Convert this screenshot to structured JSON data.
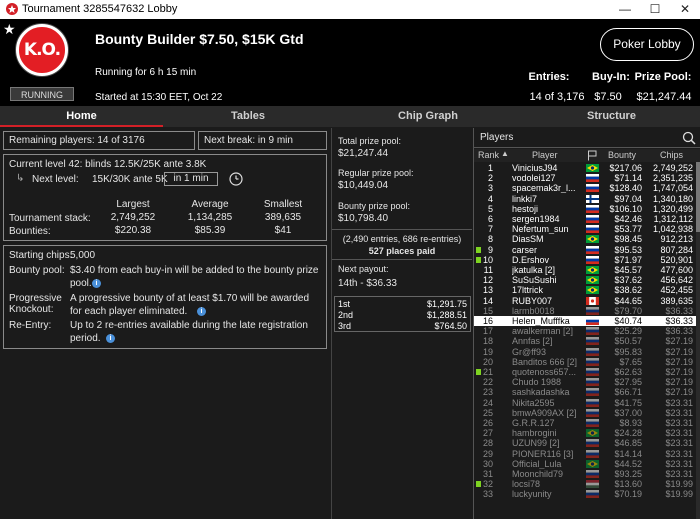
{
  "window": {
    "title": "Tournament 3285547632 Lobby",
    "minimize": "—",
    "maximize": "☐",
    "close": "✕"
  },
  "header": {
    "logo_text": "K.O.",
    "status": "RUNNING",
    "name": "Bounty Builder $7.50, $15K Gtd",
    "running_for": "Running for 6 h 15 min",
    "started": "Started at 15:30 EET, Oct 22",
    "lobby_button": "Poker Lobby",
    "entries_label": "Entries:",
    "entries_value": "14 of 3,176",
    "buyin_label": "Buy-In:",
    "buyin_value": "$7.50",
    "prize_label": "Prize Pool:",
    "prize_value": "$21,247.44"
  },
  "tabs": [
    "Home",
    "Tables",
    "Chip Graph",
    "Structure"
  ],
  "home": {
    "remaining": "Remaining players: 14 of 3176",
    "next_break": "Next break: in 9 min",
    "current_level": "Current level 42:  blinds 12.5K/25K ante 3.8K",
    "next_level_label": "Next level:",
    "next_level_value": "15K/30K ante 5K",
    "next_level_time": "in 1 min",
    "stats_headers": [
      "Largest",
      "Average",
      "Smallest"
    ],
    "stack_label": "Tournament stack:",
    "stack_values": [
      "2,749,252",
      "1,134,285",
      "389,635"
    ],
    "bounty_label": "Bounties:",
    "bounty_values": [
      "$220.38",
      "$85.39",
      "$41"
    ],
    "starting_chips_label": "Starting chips:",
    "starting_chips_value": "5,000",
    "bounty_pool_label": "Bounty pool:",
    "bounty_pool_value_1": "$3.40 from each buy-in will be added to the bounty prize",
    "bounty_pool_value_2": "pool.",
    "progressive_label_1": "Progressive",
    "progressive_label_2": "Knockout:",
    "progressive_value_1": "A progressive bounty of at least $1.70 will be awarded",
    "progressive_value_2": "for each player eliminated.",
    "reentry_label": "Re-Entry:",
    "reentry_value_1": "Up to 2 re-entries available during the late registration",
    "reentry_value_2": "period."
  },
  "prizes": {
    "total_label": "Total prize pool:",
    "total_value": "$21,247.44",
    "regular_label": "Regular prize pool:",
    "regular_value": "$10,449.04",
    "bounty_label": "Bounty prize pool:",
    "bounty_value": "$10,798.40",
    "entries_note": "(2,490 entries, 686 re-entries)",
    "places_paid": "527 places paid",
    "next_payout_label": "Next payout:",
    "next_payout_value": "14th - $36.33",
    "payouts": [
      {
        "place": "1st",
        "amount": "$1,291.75"
      },
      {
        "place": "2nd",
        "amount": "$1,288.51"
      },
      {
        "place": "3rd",
        "amount": "$764.50"
      }
    ]
  },
  "players_panel": {
    "title": "Players",
    "columns": {
      "rank": "Rank",
      "player": "Player",
      "bounty": "Bounty",
      "chips": "Chips"
    },
    "rows": [
      {
        "rank": "1",
        "name": "ViniciusJ94",
        "flag": "br",
        "bounty": "$217.06",
        "chips": "2,749,252",
        "state": ""
      },
      {
        "rank": "2",
        "name": "vodolei127",
        "flag": "ru",
        "bounty": "$71.14",
        "chips": "2,351,235",
        "state": ""
      },
      {
        "rank": "3",
        "name": "spacemak3r_l...",
        "flag": "ru",
        "bounty": "$128.40",
        "chips": "1,747,054",
        "state": ""
      },
      {
        "rank": "4",
        "name": "linkki7",
        "flag": "fi",
        "bounty": "$97.04",
        "chips": "1,340,180",
        "state": ""
      },
      {
        "rank": "5",
        "name": "hestoji",
        "flag": "ru",
        "bounty": "$106.10",
        "chips": "1,320,499",
        "state": ""
      },
      {
        "rank": "6",
        "name": "sergen1984",
        "flag": "ru",
        "bounty": "$42.46",
        "chips": "1,312,112",
        "state": ""
      },
      {
        "rank": "7",
        "name": "Nefertum_sun",
        "flag": "ru",
        "bounty": "$53.77",
        "chips": "1,042,938",
        "state": ""
      },
      {
        "rank": "8",
        "name": "DiasSM",
        "flag": "br",
        "bounty": "$98.45",
        "chips": "912,213",
        "state": ""
      },
      {
        "rank": "9",
        "name": "carser",
        "flag": "ru",
        "bounty": "$95.53",
        "chips": "807,284",
        "state": "",
        "marker": true
      },
      {
        "rank": "10",
        "name": "D.Ershov",
        "flag": "ru",
        "bounty": "$71.97",
        "chips": "520,901",
        "state": "",
        "marker": true
      },
      {
        "rank": "11",
        "name": "jkatulka [2]",
        "flag": "br",
        "bounty": "$45.57",
        "chips": "477,600",
        "state": ""
      },
      {
        "rank": "12",
        "name": "SuSuSushi",
        "flag": "br",
        "bounty": "$37.62",
        "chips": "456,642",
        "state": ""
      },
      {
        "rank": "13",
        "name": "17lttrick",
        "flag": "br",
        "bounty": "$38.62",
        "chips": "452,455",
        "state": ""
      },
      {
        "rank": "14",
        "name": "RUBY007",
        "flag": "ca",
        "bounty": "$44.65",
        "chips": "389,635",
        "state": ""
      },
      {
        "rank": "15",
        "name": "larmb0018",
        "flag": "ru",
        "bounty": "$79.70",
        "chips": "$36.33",
        "state": "elim"
      },
      {
        "rank": "16",
        "name": "Helen_Mufffka",
        "flag": "ru",
        "bounty": "$40.74",
        "chips": "$36.33",
        "state": "me"
      },
      {
        "rank": "17",
        "name": "awalkerman [2]",
        "flag": "ru",
        "bounty": "$25.29",
        "chips": "$36.33",
        "state": "elim"
      },
      {
        "rank": "18",
        "name": "Annfas [2]",
        "flag": "ru",
        "bounty": "$50.57",
        "chips": "$27.19",
        "state": "elim"
      },
      {
        "rank": "19",
        "name": "Gr@ff93",
        "flag": "ru",
        "bounty": "$95.83",
        "chips": "$27.19",
        "state": "elim"
      },
      {
        "rank": "20",
        "name": "Banditos 666 [2]",
        "flag": "ru",
        "bounty": "$7.65",
        "chips": "$27.19",
        "state": "elim"
      },
      {
        "rank": "21",
        "name": "quotenoss657...",
        "flag": "ru",
        "bounty": "$62.63",
        "chips": "$27.19",
        "state": "elim",
        "marker": true
      },
      {
        "rank": "22",
        "name": "Chudo 1988",
        "flag": "ru",
        "bounty": "$27.95",
        "chips": "$27.19",
        "state": "elim"
      },
      {
        "rank": "23",
        "name": "sashkadashka",
        "flag": "ru",
        "bounty": "$66.71",
        "chips": "$27.19",
        "state": "elim"
      },
      {
        "rank": "24",
        "name": "Nikita2595",
        "flag": "ru",
        "bounty": "$41.75",
        "chips": "$23.31",
        "state": "elim"
      },
      {
        "rank": "25",
        "name": "bmwA909AX [2]",
        "flag": "ru",
        "bounty": "$37.00",
        "chips": "$23.31",
        "state": "elim"
      },
      {
        "rank": "26",
        "name": "G.R.R.127",
        "flag": "ru",
        "bounty": "$8.93",
        "chips": "$23.31",
        "state": "elim"
      },
      {
        "rank": "27",
        "name": "hambrogini",
        "flag": "br",
        "bounty": "$24.28",
        "chips": "$23.31",
        "state": "elim"
      },
      {
        "rank": "28",
        "name": "UZUN99 [2]",
        "flag": "ru",
        "bounty": "$46.85",
        "chips": "$23.31",
        "state": "elim"
      },
      {
        "rank": "29",
        "name": "PIONER116 [3]",
        "flag": "ru",
        "bounty": "$14.14",
        "chips": "$23.31",
        "state": "elim"
      },
      {
        "rank": "30",
        "name": "Official_Lula",
        "flag": "br",
        "bounty": "$44.52",
        "chips": "$23.31",
        "state": "elim"
      },
      {
        "rank": "31",
        "name": "Moonchild79",
        "flag": "ru",
        "bounty": "$93.25",
        "chips": "$23.31",
        "state": "elim"
      },
      {
        "rank": "32",
        "name": "locsi78",
        "flag": "hu",
        "bounty": "$13.60",
        "chips": "$19.99",
        "state": "elim",
        "marker": true
      },
      {
        "rank": "33",
        "name": "luckyunity",
        "flag": "ru",
        "bounty": "$70.19",
        "chips": "$19.99",
        "state": "elim"
      }
    ]
  },
  "colors": {
    "accent": "#d32027",
    "marker": "#7ed321",
    "info": "#4a90d9"
  }
}
